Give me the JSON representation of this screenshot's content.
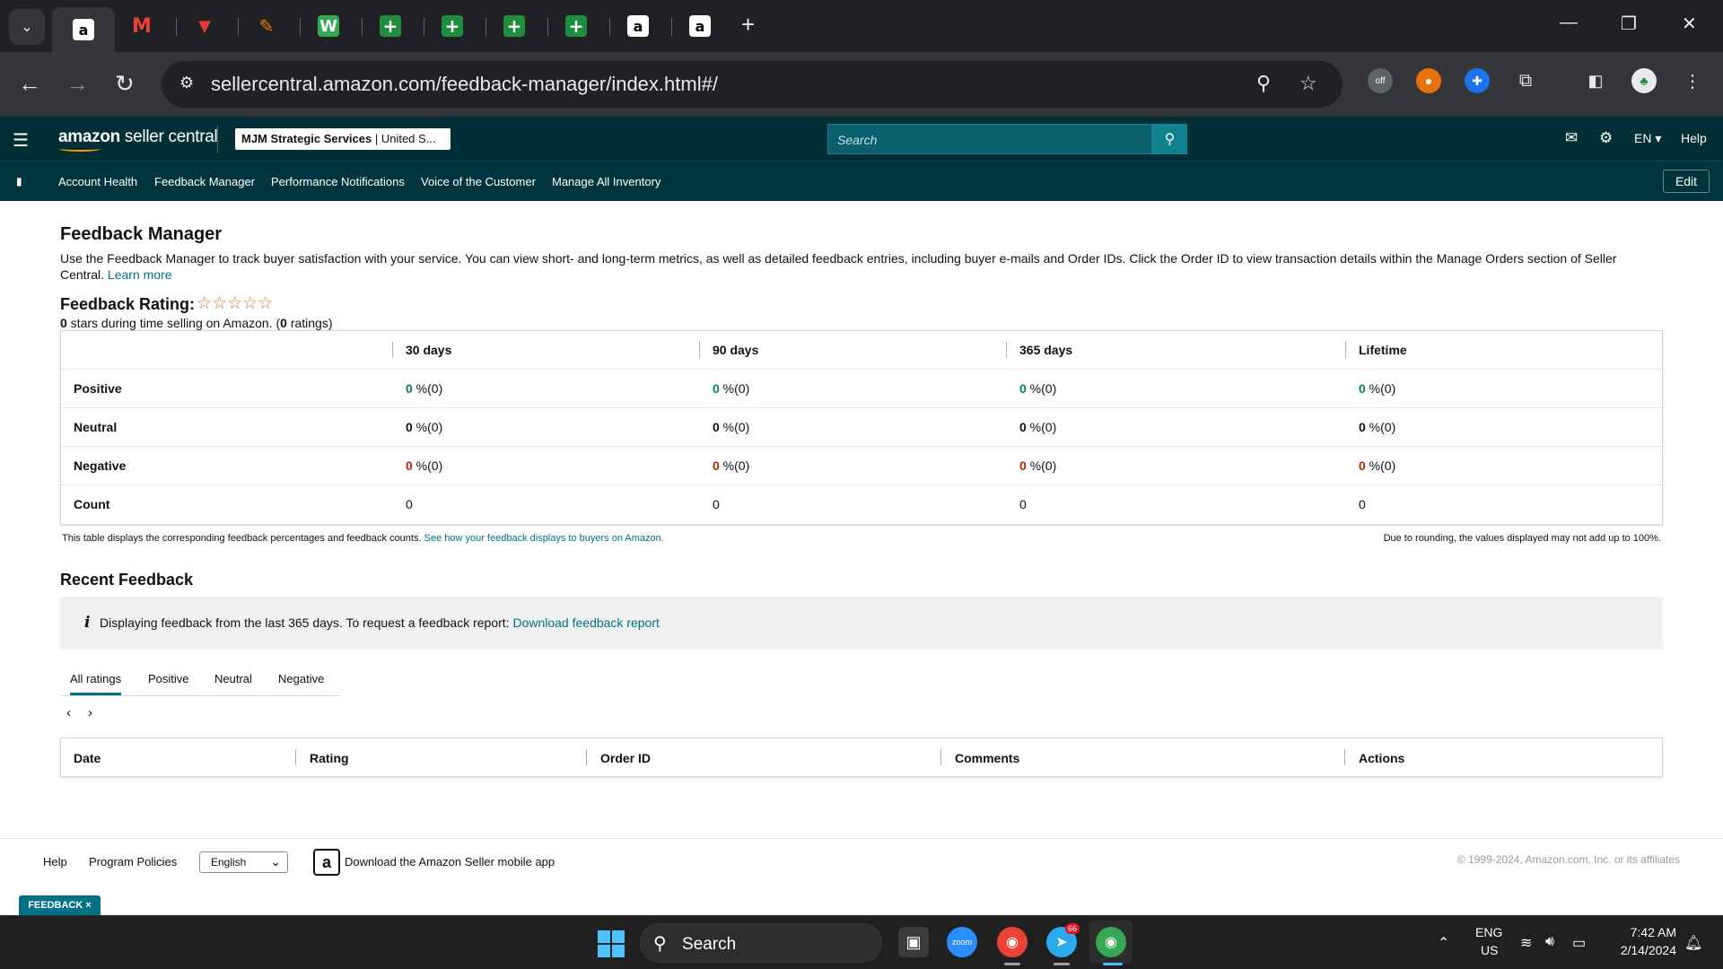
{
  "browser": {
    "url": "sellercentral.amazon.com/feedback-manager/index.html#/",
    "tabs": [
      "amazon",
      "gmail",
      "red-app",
      "pencil-app",
      "w-app",
      "sheets",
      "sheets",
      "sheets",
      "sheets",
      "amazon",
      "amazon"
    ]
  },
  "header": {
    "logo_main": "amazon",
    "logo_sub": " seller central",
    "account_bold": "MJM Strategic Services",
    "account_rest": " | United S...",
    "search_placeholder": "Search",
    "language": "EN",
    "help": "Help"
  },
  "nav": {
    "items": [
      "Account Health",
      "Feedback Manager",
      "Performance Notifications",
      "Voice of the Customer",
      "Manage All Inventory"
    ],
    "edit": "Edit"
  },
  "page": {
    "title": "Feedback Manager",
    "intro": "Use the Feedback Manager to track buyer satisfaction with your service. You can view short- and long-term metrics, as well as detailed feedback entries, including buyer e-mails and Order IDs. Click the Order ID to view transaction details within the Manage Orders section of Seller Central.",
    "learn_more": "Learn more",
    "rating_title": "Feedback Rating:",
    "stars": "☆☆☆☆☆",
    "rating_count_a": "0",
    "rating_sub_a": " stars during time selling on Amazon. (",
    "rating_count_b": "0",
    "rating_sub_b": " ratings)"
  },
  "feedback_table": {
    "columns": [
      "30 days",
      "90 days",
      "365 days",
      "Lifetime"
    ],
    "rows": [
      {
        "label": "Positive",
        "value": "0",
        "suffix": " %(0)"
      },
      {
        "label": "Neutral",
        "value": "0",
        "suffix": " %(0)"
      },
      {
        "label": "Negative",
        "value": "0",
        "suffix": " %(0)"
      },
      {
        "label": "Count",
        "value": "0",
        "suffix": ""
      }
    ],
    "note_left": "This table displays the corresponding feedback percentages and feedback counts.",
    "note_link": "See how your feedback displays to buyers on Amazon.",
    "note_right": "Due to rounding, the values displayed may not add up to 100%."
  },
  "recent": {
    "title": "Recent Feedback",
    "info_icon": "i",
    "info_text": "Displaying feedback from the last 365 days. To request a feedback report:",
    "info_link": "Download feedback report",
    "tabs": [
      "All ratings",
      "Positive",
      "Neutral",
      "Negative"
    ],
    "columns": [
      "Date",
      "Rating",
      "Order ID",
      "Comments",
      "Actions"
    ]
  },
  "footer": {
    "help": "Help",
    "policies": "Program Policies",
    "language": "English",
    "app_text": "Download the Amazon Seller mobile app",
    "copyright": "© 1999-2024, Amazon.com, Inc. or its affiliates",
    "feedback_tab": "FEEDBACK ×"
  },
  "taskbar": {
    "search": "Search",
    "lang_top": "ENG",
    "lang_bottom": "US",
    "time": "7:42 AM",
    "date": "2/14/2024",
    "telegram_badge": "66",
    "zoom_label": "zoom"
  },
  "colors": {
    "header_bg": "#002f36",
    "nav_bg": "#00353f",
    "link": "#007185",
    "positive": "#067d62",
    "negative": "#b12704",
    "star": "#de7921"
  }
}
